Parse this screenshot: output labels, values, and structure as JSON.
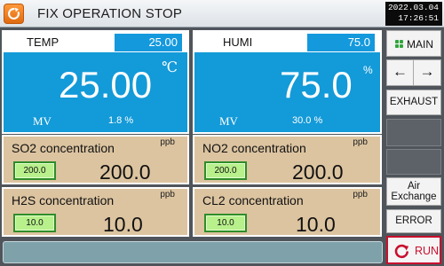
{
  "header": {
    "title": "FIX OPERATION STOP",
    "date": "2022.03.04",
    "time": "17:26:51",
    "logo_icon": "refresh-icon"
  },
  "temp": {
    "label": "TEMP",
    "setpoint": "25.00",
    "value": "25.00",
    "unit": "℃",
    "mv_label": "MV",
    "mv_value": "1.8 %"
  },
  "humi": {
    "label": "HUMI",
    "setpoint": "75.0",
    "value": "75.0",
    "unit": "%",
    "mv_label": "MV",
    "mv_value": "30.0 %"
  },
  "gases": {
    "so2": {
      "label": "SO2 concentration",
      "unit": "ppb",
      "setpoint": "200.0",
      "value": "200.0"
    },
    "no2": {
      "label": "NO2 concentration",
      "unit": "ppb",
      "setpoint": "200.0",
      "value": "200.0"
    },
    "h2s": {
      "label": "H2S concentration",
      "unit": "ppb",
      "setpoint": "10.0",
      "value": "10.0"
    },
    "cl2": {
      "label": "CL2 concentration",
      "unit": "ppb",
      "setpoint": "10.0",
      "value": "10.0"
    }
  },
  "sidebar": {
    "main": "MAIN",
    "back": "←",
    "forward": "→",
    "exhaust": "EXHAUST",
    "air_line1": "Air",
    "air_line2": "Exchange",
    "error": "ERROR",
    "run": "RUN"
  },
  "colors": {
    "panel_blue": "#139ad8",
    "gas_panel": "#dcc4a0",
    "setpoint_green": "#b8f08c",
    "run_red": "#c8102e",
    "logo_orange": "#f07e20"
  }
}
